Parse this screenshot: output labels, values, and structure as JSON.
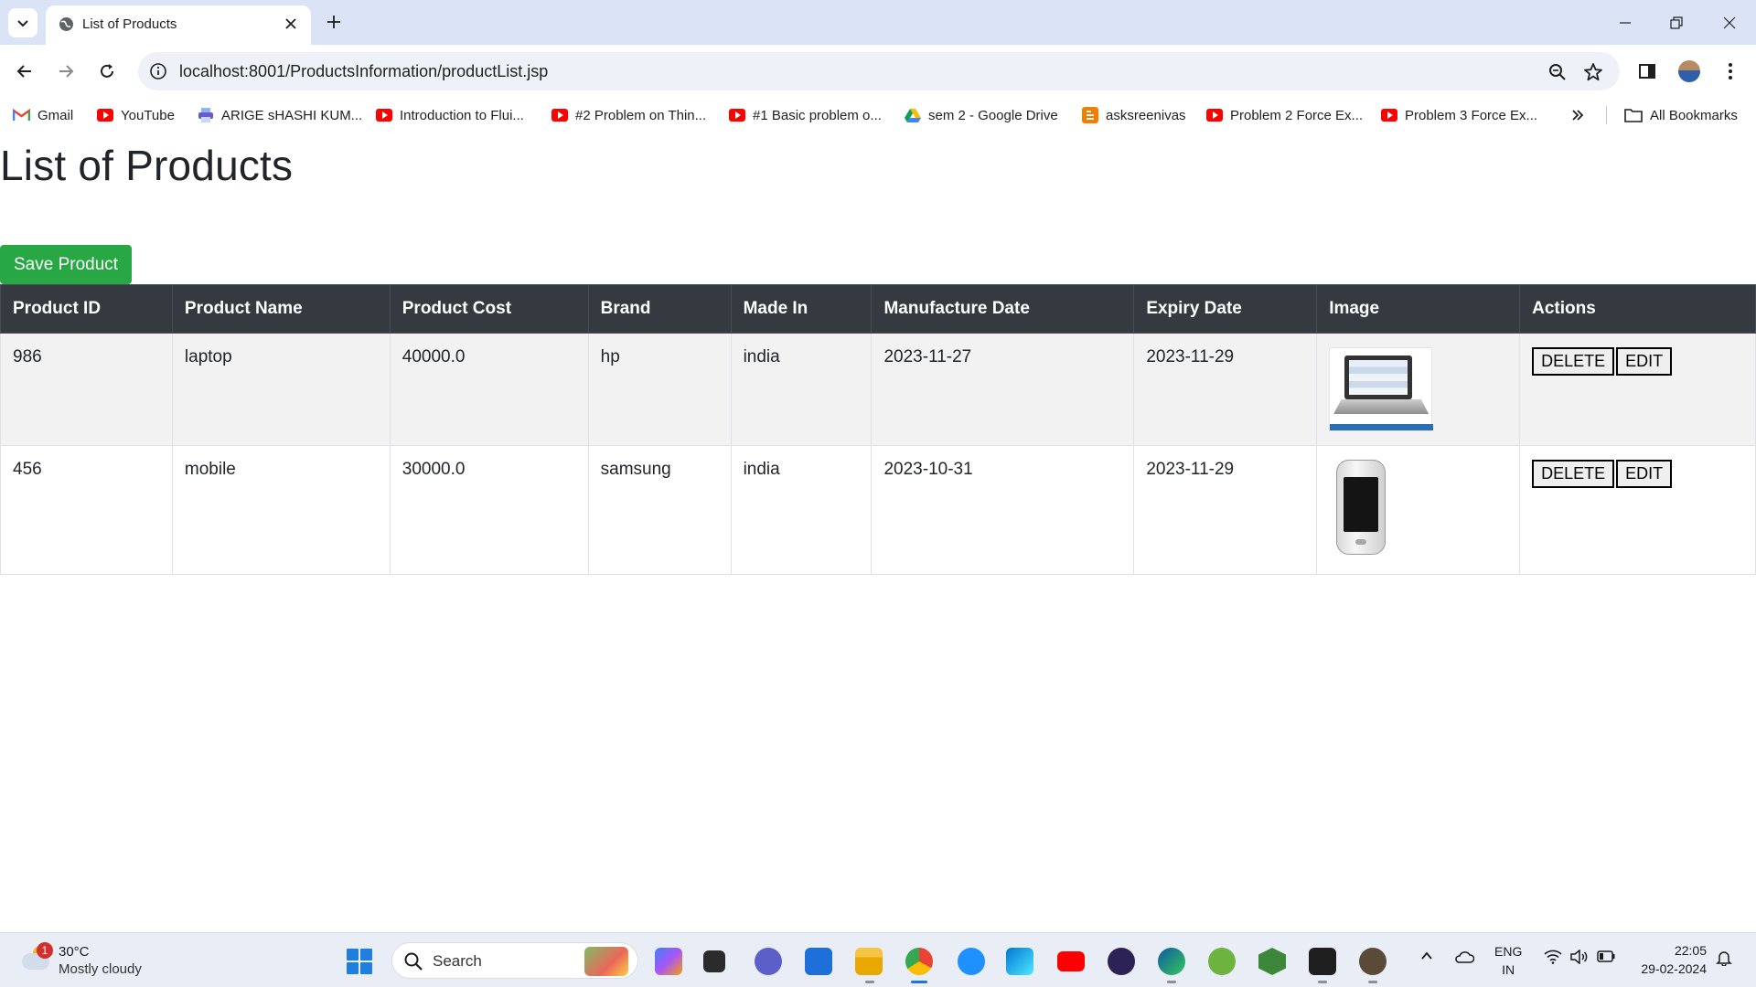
{
  "browser": {
    "tab_title": "List of Products",
    "url": "localhost:8001/ProductsInformation/productList.jsp",
    "bookmarks": [
      {
        "label": "Gmail",
        "icon": "gmail-icon"
      },
      {
        "label": "YouTube",
        "icon": "youtube-icon"
      },
      {
        "label": "ARIGE sHASHI KUM...",
        "icon": "printer-icon"
      },
      {
        "label": "Introduction to Flui...",
        "icon": "youtube-icon"
      },
      {
        "label": "#2 Problem on Thin...",
        "icon": "youtube-icon"
      },
      {
        "label": "#1 Basic problem o...",
        "icon": "youtube-icon"
      },
      {
        "label": "sem 2 - Google Drive",
        "icon": "google-drive-icon"
      },
      {
        "label": "asksreenivas",
        "icon": "blogger-icon"
      },
      {
        "label": "Problem 2 Force Ex...",
        "icon": "youtube-icon"
      },
      {
        "label": "Problem 3 Force Ex...",
        "icon": "youtube-icon"
      }
    ],
    "all_bookmarks_label": "All Bookmarks"
  },
  "page": {
    "title": "List of Products",
    "save_button_label": "Save Product",
    "table": {
      "headers": [
        "Product ID",
        "Product Name",
        "Product Cost",
        "Brand",
        "Made In",
        "Manufacture Date",
        "Expiry Date",
        "Image",
        "Actions"
      ],
      "rows": [
        {
          "id": "986",
          "name": "laptop",
          "cost": "40000.0",
          "brand": "hp",
          "made_in": "india",
          "manufacture_date": "2023-11-27",
          "expiry_date": "2023-11-29",
          "image": "laptop-image"
        },
        {
          "id": "456",
          "name": "mobile",
          "cost": "30000.0",
          "brand": "samsung",
          "made_in": "india",
          "manufacture_date": "2023-10-31",
          "expiry_date": "2023-11-29",
          "image": "mobile-phone-image"
        }
      ],
      "delete_label": "DELETE",
      "edit_label": "EDIT"
    }
  },
  "taskbar": {
    "weather_badge": "1",
    "temperature": "30°C",
    "condition": "Mostly cloudy",
    "search_placeholder": "Search",
    "language_top": "ENG",
    "language_bottom": "IN",
    "time": "22:05",
    "date": "29-02-2024"
  },
  "colors": {
    "save_button": "#28a745",
    "table_header": "#343a40",
    "striped_row": "#f2f2f2",
    "browser_frame": "#dbe4f7"
  }
}
